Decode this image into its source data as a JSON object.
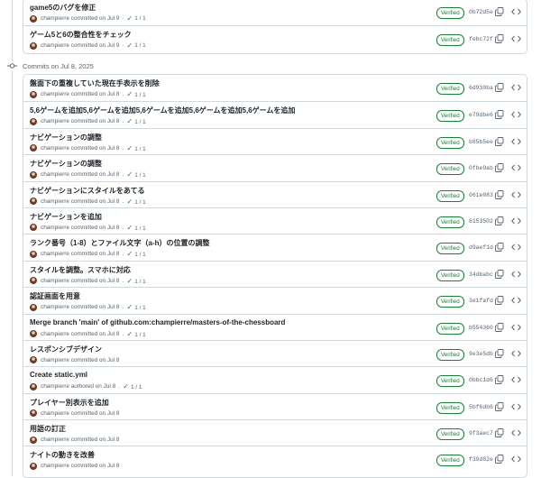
{
  "verified_label": "Verified",
  "groups": [
    {
      "header": "",
      "commits": [
        {
          "message": "game5のバグを修正",
          "author": "champierre",
          "action": "committed on Jul 9",
          "checks": "1 / 1",
          "sha": "0b72d5e"
        },
        {
          "message": "ゲーム5と6の整合性をチェック",
          "author": "champierre",
          "action": "committed on Jul 9",
          "checks": "1 / 1",
          "sha": "febc72f"
        }
      ]
    },
    {
      "header": "Commits on Jul 8, 2025",
      "commits": [
        {
          "message": "盤面下の重複していた現在手表示を削除",
          "author": "champierre",
          "action": "committed on Jul 8",
          "checks": "1 / 1",
          "sha": "6d930ba"
        },
        {
          "message": "5,6ゲームを追加5,6ゲームを追加5,6ゲームを追加5,6ゲームを追加5,6ゲームを追加",
          "author": "champierre",
          "action": "committed on Jul 8",
          "checks": "1 / 1",
          "sha": "e79dbe6"
        },
        {
          "message": "ナビゲーションの調整",
          "author": "champierre",
          "action": "committed on Jul 8",
          "checks": "1 / 1",
          "sha": "b85b5ee"
        },
        {
          "message": "ナビゲーションの調整",
          "author": "champierre",
          "action": "committed on Jul 8",
          "checks": "1 / 1",
          "sha": "0fbe9ab"
        },
        {
          "message": "ナビゲーションにスタイルをあてる",
          "author": "champierre",
          "action": "committed on Jul 8",
          "checks": "1 / 1",
          "sha": "061e083"
        },
        {
          "message": "ナビゲーションを追加",
          "author": "champierre",
          "action": "committed on Jul 8",
          "checks": "1 / 1",
          "sha": "6153502"
        },
        {
          "message": "ランク番号（1-8）とファイル文字（a-h）の位置の調整",
          "author": "champierre",
          "action": "committed on Jul 8",
          "checks": "1 / 1",
          "sha": "d9aef1d"
        },
        {
          "message": "スタイルを調整。スマホに対応",
          "author": "champierre",
          "action": "committed on Jul 8",
          "checks": "1 / 1",
          "sha": "34dbabc"
        },
        {
          "message": "認証画面を用意",
          "author": "champierre",
          "action": "committed on Jul 8",
          "checks": "1 / 1",
          "sha": "3e1fafd"
        },
        {
          "message": "Merge branch 'main' of github.com:champierre/masters-of-the-chessboard",
          "author": "champierre",
          "action": "committed on Jul 8",
          "checks": "1 / 1",
          "sha": "b554360"
        },
        {
          "message": "レスポンシブデザイン",
          "author": "champierre",
          "action": "committed on Jul 8",
          "checks": "",
          "sha": "9e3e5db"
        },
        {
          "message": "Create static.yml",
          "author": "champierre",
          "action": "authored on Jul 8",
          "checks": "1 / 1",
          "sha": "0bbc1d6"
        },
        {
          "message": "プレイヤー別表示を追加",
          "author": "champierre",
          "action": "committed on Jul 8",
          "checks": "",
          "sha": "5bf6db6"
        },
        {
          "message": "用語の訂正",
          "author": "champierre",
          "action": "committed on Jul 8",
          "checks": "",
          "sha": "9f3aec7"
        },
        {
          "message": "ナイトの動きを改善",
          "author": "champierre",
          "action": "committed on Jul 8",
          "checks": "",
          "sha": "f39d82e"
        }
      ]
    }
  ]
}
